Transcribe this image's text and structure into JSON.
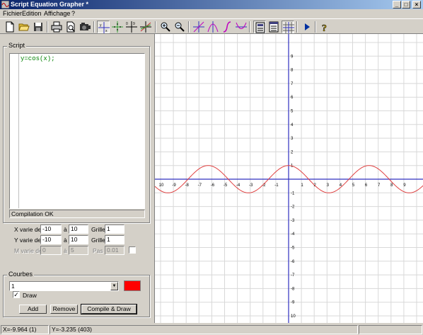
{
  "window": {
    "title": "Script Equation Grapher *"
  },
  "menu": [
    "Fichier",
    "Edition",
    "Affichage",
    "?"
  ],
  "toolbar": {
    "buttons": [
      "new-file",
      "open-folder",
      "save",
      "print",
      "print-preview",
      "export-camera",
      "axes-xy",
      "axes-scale",
      "axes-labels",
      "axes-curves",
      "zoom-in",
      "zoom-out",
      "curve-tangent",
      "curve-parabola",
      "curve-integral",
      "curve-derivative",
      "calculator",
      "table-view",
      "grid-toggle",
      "run",
      "help"
    ]
  },
  "script": {
    "group_label": "Script",
    "code": "y=cos(x);",
    "compile_status": "Compilation OK"
  },
  "ranges": {
    "x_label": "X varie de",
    "x_from": "-10",
    "x_to_label": "à",
    "x_to": "10",
    "x_grid_label": "Grille",
    "x_grid": "1",
    "y_label": "Y varie de",
    "y_from": "-10",
    "y_to_label": "à",
    "y_to": "10",
    "y_grid_label": "Grille",
    "y_grid": "1",
    "m_label": "M varie de",
    "m_from": "0",
    "m_to_label": "à",
    "m_to": "5",
    "m_step_label": "Pas :",
    "m_step": "0.01"
  },
  "curves": {
    "group_label": "Courbes",
    "selected": "1",
    "color": "#ff0000",
    "draw_label": "Draw",
    "draw_checked": true,
    "add_label": "Add",
    "remove_label": "Remove",
    "compile_label": "Compile & Draw"
  },
  "graph": {
    "expression": "cos(x)",
    "x_tick_labels": [
      "10",
      "-9",
      "-8",
      "-7",
      "-6",
      "-5",
      "-4",
      "-3",
      "-2",
      "-1",
      "1",
      "2",
      "3",
      "4",
      "5",
      "6",
      "7",
      "8",
      "9"
    ],
    "y_tick_labels": [
      "9",
      "8",
      "7",
      "6",
      "5",
      "4",
      "3",
      "2",
      "1",
      "-1",
      "-2",
      "-3",
      "-4",
      "-5",
      "-6",
      "-7",
      "-8",
      "-9",
      "10"
    ],
    "axis_color": "#3030c0",
    "grid_color": "#d8d8d8",
    "curve_color": "#e04040"
  },
  "status": {
    "x_readout": "X=-9.964 (1)",
    "y_readout": "Y=-3.235 (403)"
  }
}
